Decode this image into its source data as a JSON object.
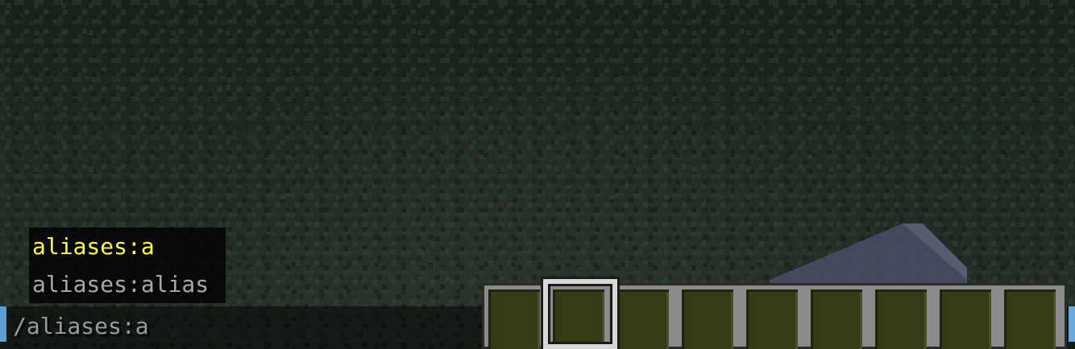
{
  "chat": {
    "suggestions": [
      {
        "text": "aliases:a",
        "selected": true
      },
      {
        "text": "aliases:alias",
        "selected": false
      }
    ],
    "input_value": "/aliases:a"
  },
  "hotbar": {
    "slot_count": 9,
    "selected_slot": 2
  },
  "colors": {
    "selected_suggestion": "#ffff3c",
    "suggestion": "#a8a8a8",
    "input_text": "#9a9a9a",
    "ground": "#1e2a22",
    "hotbar_frame": "#8b8b8b",
    "slot_fill": "#363b17",
    "selector": "#d7d7d7",
    "input_accent": "#5e9fd6"
  }
}
